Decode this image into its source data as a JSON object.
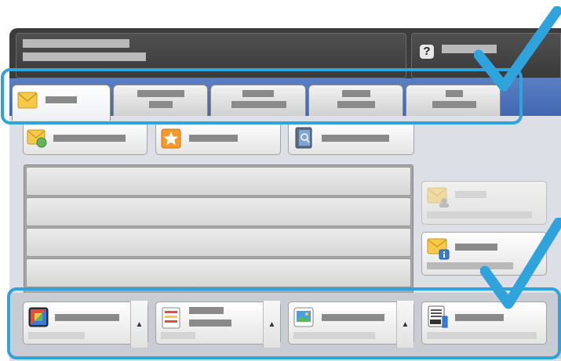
{
  "header": {
    "help_icon": "question-mark-icon",
    "help_glyph": "?"
  },
  "colors": {
    "highlight": "#2fa3dc",
    "blue_band": "#3d64ad",
    "frame": "#3c3c3c"
  },
  "tabs": [
    {
      "icon": "envelope-icon",
      "active": true
    },
    {
      "active": false
    },
    {
      "active": false
    },
    {
      "active": false
    },
    {
      "active": false
    }
  ],
  "top_buttons": [
    {
      "icon": "envelope-gear-icon"
    },
    {
      "icon": "star-icon"
    },
    {
      "icon": "address-book-icon"
    }
  ],
  "side_buttons": [
    {
      "icon": "envelope-user-icon",
      "enabled": false
    },
    {
      "icon": "envelope-info-icon",
      "enabled": true
    }
  ],
  "bottom_buttons": [
    {
      "icon": "color-output-icon",
      "arrow": "▲"
    },
    {
      "icon": "document-lines-icon",
      "arrow": "▲"
    },
    {
      "icon": "image-photo-icon",
      "arrow": "▲"
    },
    {
      "icon": "file-format-icon"
    }
  ]
}
